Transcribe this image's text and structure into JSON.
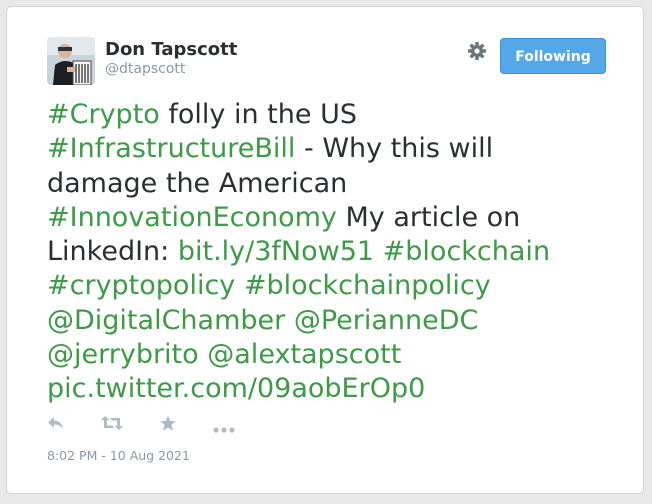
{
  "user": {
    "name": "Don Tapscott",
    "handle": "@dtapscott"
  },
  "follow_button": {
    "label": "Following"
  },
  "icons": {
    "settings": "gear-icon",
    "reply": "reply-icon",
    "retweet": "retweet-icon",
    "favorite": "star-icon",
    "more": "more-icon"
  },
  "tweet": {
    "segments": {
      "s1": "#Crypto",
      "s2": " folly in the US",
      "s3": "#InfrastructureBill",
      "s4": " - Why this will",
      "s5": "damage the American",
      "s6": "#InnovationEconomy",
      "s7": " My article on",
      "s8": "LinkedIn: ",
      "s9": "bit.ly/3fNow51",
      "s10": " ",
      "s11": "#blockchain",
      "s12": "#cryptopolicy",
      "s13": " ",
      "s14": "#blockchainpolicy",
      "s15": "@DigitalChamber",
      "s16": " ",
      "s17": "@PerianneDC",
      "s18": "@jerrybrito",
      "s19": " ",
      "s20": "@alextapscott",
      "s21": "pic.twitter.com/09aobErOp0"
    }
  },
  "timestamp": "8:02 PM - 10 Aug 2021",
  "colors": {
    "link": "#3d9a46",
    "text": "#292f33",
    "muted": "#8899a6",
    "button": "#56a7e8"
  }
}
